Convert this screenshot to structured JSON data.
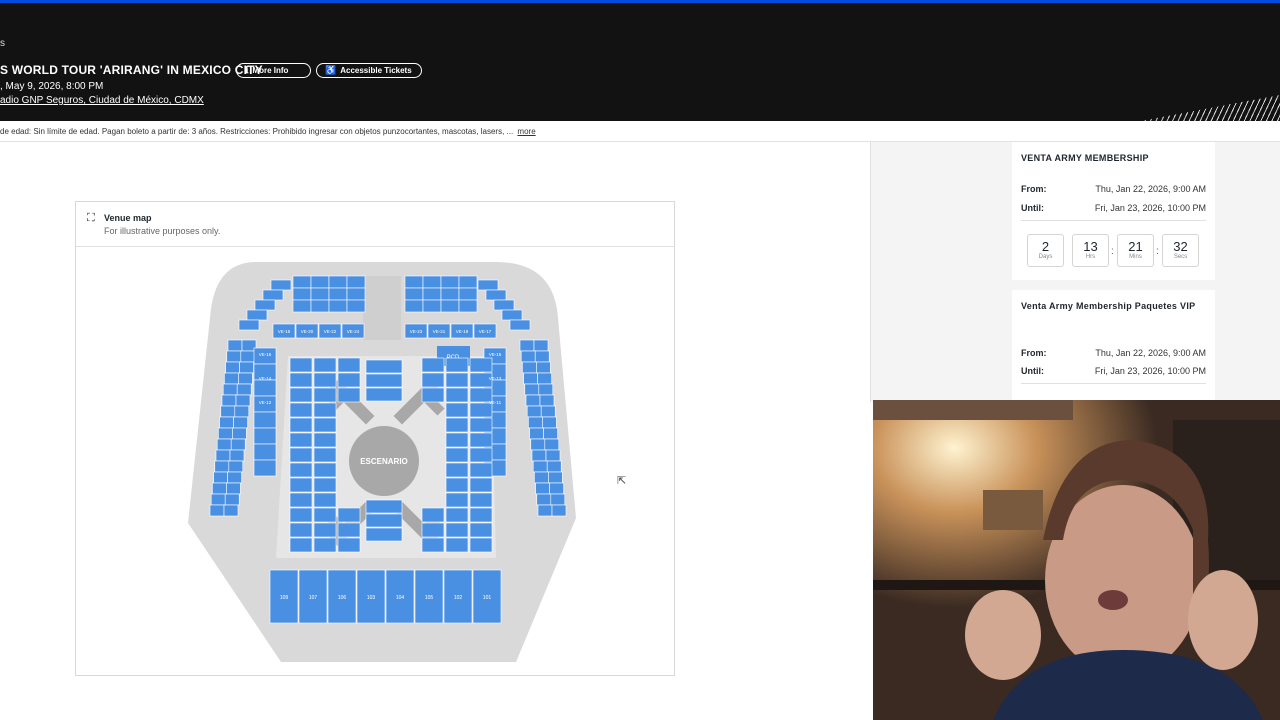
{
  "header": {
    "breadcrumb": "s",
    "event_title": "S WORLD TOUR 'ARIRANG' IN MEXICO CITY",
    "more_info": "More Info",
    "accessible_tickets": "Accessible Tickets",
    "date": ", May 9, 2026, 8:00 PM",
    "venue": "adio GNP Seguros, Ciudad de México, CDMX"
  },
  "notice": {
    "text": "de edad: Sin límite de edad. Pagan boleto a partir de: 3 años. Restricciones: Prohibido ingresar con objetos punzocortantes, mascotas, lasers, ...",
    "more": "more"
  },
  "venue_map": {
    "title": "Venue map",
    "subtitle": "For illustrative purposes only.",
    "stage_label": "ESCENARIO",
    "pcd_label": "PCD",
    "floor_labels": [
      "109",
      "107",
      "106",
      "103",
      "104",
      "105",
      "102",
      "101"
    ],
    "top_left_labels": [
      "VE-18",
      "VE-20",
      "VE-22",
      "VE-24"
    ],
    "top_right_labels": [
      "VE-23",
      "VE-21",
      "VE-19",
      "VE-17"
    ],
    "side_left_labels": [
      "VE-16",
      "VE-14",
      "VE-12"
    ],
    "side_right_labels": [
      "VE-15",
      "VE-13",
      "VE-11"
    ]
  },
  "sales": [
    {
      "name": "VENTA ARMY MEMBERSHIP",
      "from_label": "From:",
      "from_value": "Thu, Jan 22, 2026, 9:00 AM",
      "until_label": "Until:",
      "until_value": "Fri, Jan 23, 2026, 10:00 PM",
      "countdown": [
        {
          "n": "2",
          "u": "Days"
        },
        {
          "n": "13",
          "u": "Hrs"
        },
        {
          "n": "21",
          "u": "Mins"
        },
        {
          "n": "32",
          "u": "Secs"
        }
      ]
    },
    {
      "name": "Venta Army Membership Paquetes VIP",
      "from_label": "From:",
      "from_value": "Thu, Jan 22, 2026, 9:00 AM",
      "until_label": "Until:",
      "until_value": "Fri, Jan 23, 2026, 10:00 PM"
    }
  ],
  "colors": {
    "section_blue": "#4a90e2",
    "section_gray": "#d9d9d9",
    "header_bg": "#121212",
    "accent": "#024ddf"
  },
  "icons": [
    "info-icon",
    "accessible-icon",
    "map-icon",
    "cursor-icon"
  ]
}
